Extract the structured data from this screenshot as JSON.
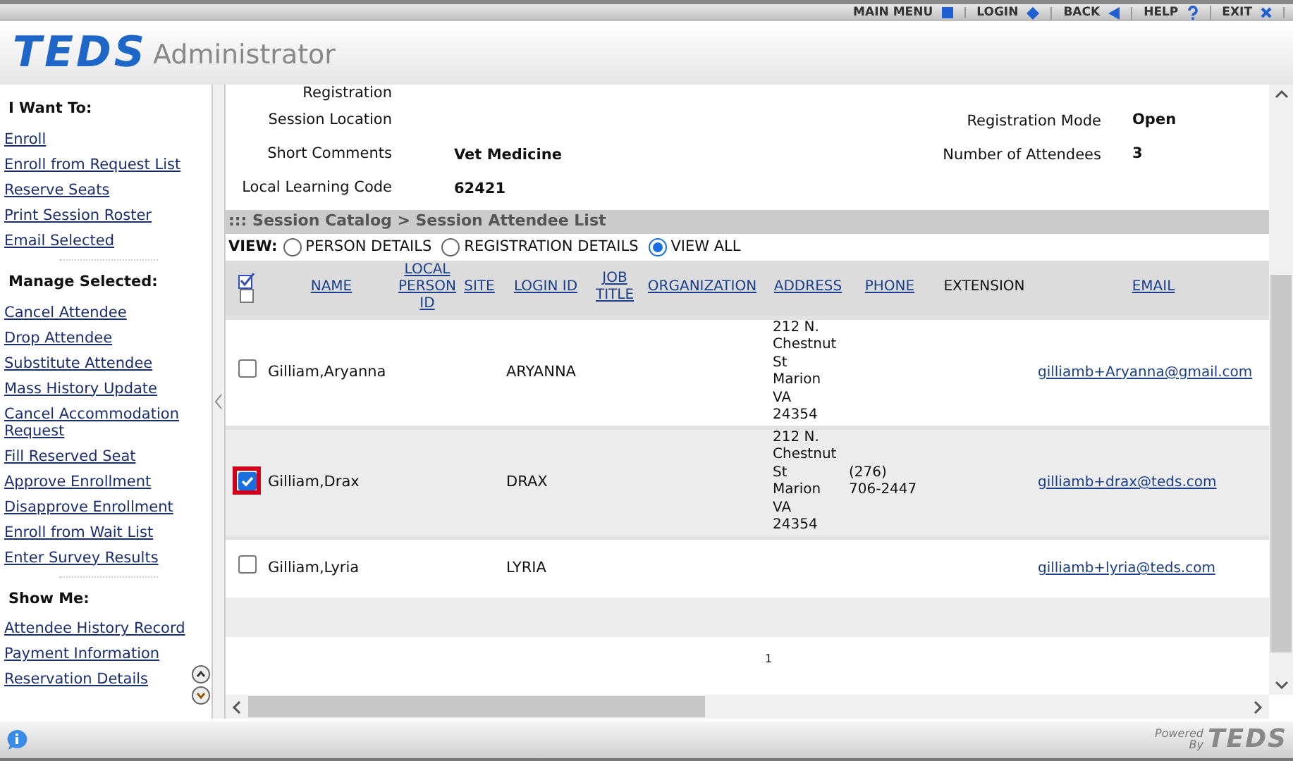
{
  "top_menu": [
    {
      "label": "MAIN MENU"
    },
    {
      "label": "LOGIN"
    },
    {
      "label": "BACK"
    },
    {
      "label": "HELP"
    },
    {
      "label": "EXIT"
    }
  ],
  "header": {
    "logo": "TEDS",
    "app_name": "Administrator"
  },
  "sidebar": {
    "sections": [
      {
        "title": "I Want To:",
        "links": [
          "Enroll",
          "Enroll from Request List",
          "Reserve Seats",
          "Print Session Roster",
          "Email Selected"
        ]
      },
      {
        "title": "Manage Selected:",
        "links": [
          "Cancel Attendee",
          "Drop Attendee",
          "Substitute Attendee",
          "Mass History Update",
          "Cancel Accommodation Request",
          "Fill Reserved Seat",
          "Approve Enrollment",
          "Disapprove Enrollment",
          "Enroll from Wait List",
          "Enter Survey Results"
        ]
      },
      {
        "title": "Show Me:",
        "links": [
          "Attendee History Record",
          "Payment Information",
          "Reservation Details"
        ]
      }
    ]
  },
  "details": [
    {
      "label": "Registration"
    },
    {
      "label": "Session Location",
      "label_2": "Registration Mode",
      "value_2": "Open"
    },
    {
      "label": "Short Comments",
      "value": "Vet Medicine",
      "label_2": "Number of Attendees",
      "value_2": "3"
    },
    {
      "label": "Local Learning Code",
      "value": "62421"
    }
  ],
  "breadcrumb": "::: Session Catalog > Session Attendee List",
  "view": {
    "label": "VIEW:",
    "options": [
      {
        "label": "PERSON DETAILS",
        "selected": false
      },
      {
        "label": "REGISTRATION DETAILS",
        "selected": false
      },
      {
        "label": "VIEW ALL",
        "selected": true
      }
    ]
  },
  "table": {
    "header_checkbox": {
      "checked": false
    },
    "columns": [
      {
        "label": "NAME",
        "link": true
      },
      {
        "label": "LOCAL PERSON ID",
        "link": true
      },
      {
        "label": "SITE",
        "link": true
      },
      {
        "label": "LOGIN ID",
        "link": true
      },
      {
        "label": "JOB TITLE",
        "link": true
      },
      {
        "label": "ORGANIZATION",
        "link": true
      },
      {
        "label": "ADDRESS",
        "link": true
      },
      {
        "label": "PHONE",
        "link": true
      },
      {
        "label": "EXTENSION",
        "link": false
      },
      {
        "label": "EMAIL",
        "link": true
      }
    ],
    "rows": [
      {
        "checked": false,
        "name": "Gilliam,Aryanna",
        "login_id": "ARYANNA",
        "address": [
          "212 N.",
          "Chestnut",
          "St",
          "Marion",
          "VA",
          "24354"
        ],
        "phone": [],
        "email": "gilliamb+Aryanna@gmail.com"
      },
      {
        "checked": true,
        "name": "Gilliam,Drax",
        "login_id": "DRAX",
        "address": [
          "212 N.",
          "Chestnut",
          "St",
          "Marion",
          "VA",
          "24354"
        ],
        "phone": [
          "(276)",
          "706-2447"
        ],
        "email": "gilliamb+drax@teds.com"
      },
      {
        "checked": false,
        "name": "Gilliam,Lyria",
        "login_id": "LYRIA",
        "address": [],
        "phone": [],
        "email": "gilliamb+lyria@teds.com"
      }
    ]
  },
  "pager": "1",
  "footer": {
    "powered": "Powered",
    "by": "By",
    "logo": "TEDS"
  }
}
